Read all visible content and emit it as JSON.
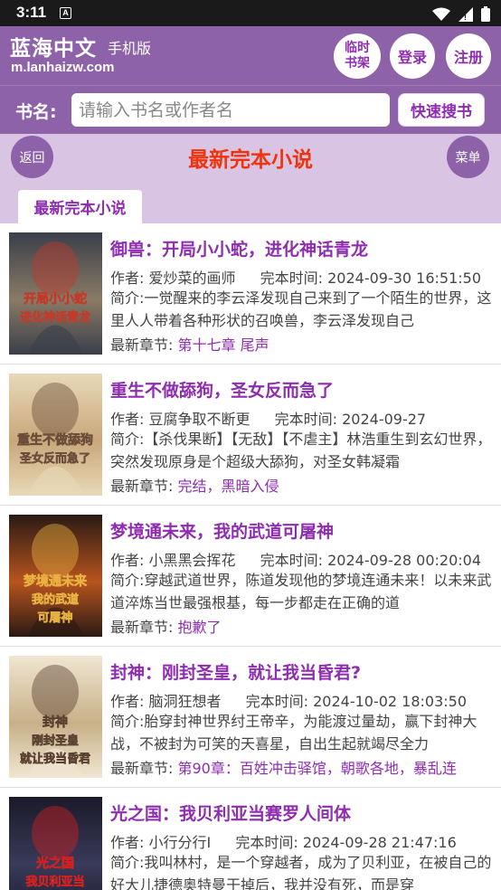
{
  "status_bar": {
    "time": "3:11",
    "notif_letter": "A"
  },
  "header": {
    "site_name": "蓝海中文",
    "site_sub": "手机版",
    "domain": "m.lanhaizw.com",
    "shelf_label": "临时书架",
    "login_label": "登录",
    "register_label": "注册"
  },
  "search": {
    "label": "书名:",
    "placeholder": "请输入书名或作者名",
    "button": "快速搜书"
  },
  "titlebar": {
    "back": "返回",
    "title": "最新完本小说",
    "menu": "菜单"
  },
  "tab": {
    "label": "最新完本小说"
  },
  "labels": {
    "author": "作者:",
    "finish_time": "完本时间:",
    "intro": "简介:",
    "latest": "最新章节:"
  },
  "books": [
    {
      "title": "御兽：开局小小蛇，进化神话青龙",
      "author": "爱炒菜的画师",
      "time": "2024-09-30 16:51:50",
      "intro": "一觉醒来的李云泽发现自己来到了一个陌生的世界，这里人人带着各种形状的召唤兽，李云泽发现自己",
      "latest": "第十七章 尾声",
      "cover_text": "开局小小蛇 进化神话青龙",
      "cover_colors": [
        "#3a3f4a",
        "#8a7a66",
        "#c23a2a"
      ]
    },
    {
      "title": "重生不做舔狗，圣女反而急了",
      "author": "豆腐争取不断更",
      "time": "2024-09-27",
      "intro": "【杀伐果断】【无敌】【不虐主】林浩重生到玄幻世界，突然发现原身是个超级大舔狗，对圣女韩凝霜",
      "latest": "完结，黑暗入侵",
      "cover_text": "重生不做舔狗 圣女反而急了",
      "cover_colors": [
        "#e8d9b8",
        "#c9a77a",
        "#6a4e3a"
      ]
    },
    {
      "title": "梦境通未来，我的武道可屠神",
      "author": "小黑黑会挥花",
      "time": "2024-09-28 00:20:04",
      "intro": "穿越武道世界，陈道发现他的梦境连通未来！以未来武道淬炼当世最强根基，每一步都走在正确的道",
      "latest": "抱歉了",
      "cover_text": "梦境通未来 我的武道 可屠神",
      "cover_colors": [
        "#2a1a14",
        "#b8541e",
        "#e8b040"
      ]
    },
    {
      "title": "封神：刚封圣皇，就让我当昏君?",
      "author": "脑洞狂想者",
      "time": "2024-10-02 18:03:50",
      "intro": "胎穿封神世界纣王帝辛，为能渡过量劫，赢下封神大战，不被封为可笑的天喜星，自出生起就竭尽全力",
      "latest": "第90章：百姓冲击驿馆，朝歌各地，暴乱连",
      "cover_text": "封神 刚封圣皇 就让我当昏君",
      "cover_colors": [
        "#f0e6d2",
        "#c8b088",
        "#5a4030"
      ]
    },
    {
      "title": "光之国：我贝利亚当赛罗人间体",
      "author": "小行分行I",
      "time": "2024-09-28 21:47:16",
      "intro": "我叫林村，是一个穿越者，成为了贝利亚，在被自己的好大儿捷德奥特曼干掉后，我并没有死，而是穿",
      "latest": "",
      "cover_text": "光之国 我贝利亚当 赛罗人间体",
      "cover_colors": [
        "#1a1a2a",
        "#3a3a5a",
        "#d02020"
      ]
    }
  ]
}
